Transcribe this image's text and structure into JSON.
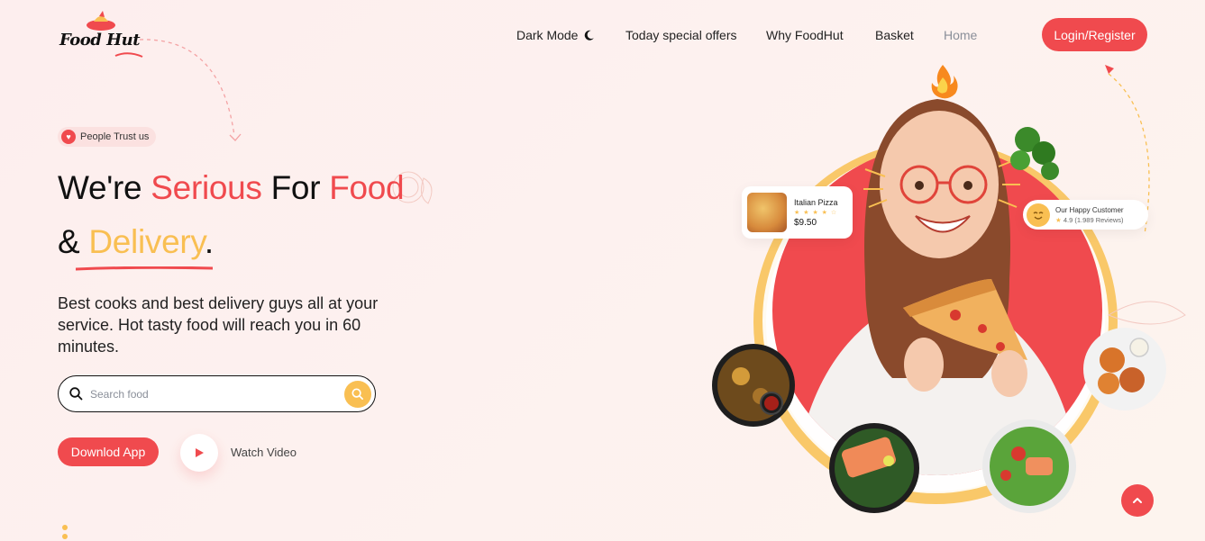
{
  "nav": {
    "logo_text": "Food Hut",
    "items": [
      {
        "label": "Dark Mode",
        "active": false
      },
      {
        "label": "Today special offers",
        "active": false
      },
      {
        "label": "Why FoodHut",
        "active": false
      },
      {
        "label": "Basket",
        "active": false
      },
      {
        "label": "Home",
        "active": true
      }
    ],
    "login_label": "Login/Register"
  },
  "hero": {
    "badge": "People Trust us",
    "headline": {
      "part1": "We're ",
      "part2": "Serious",
      "part3": " For ",
      "part4": "Food",
      "part5": "& ",
      "part6": "Delivery",
      "part7": "."
    },
    "description": "Best cooks and best delivery guys all at your service. Hot tasty food will reach you in 60 minutes.",
    "search": {
      "placeholder": "Search food",
      "value": ""
    },
    "download_label": "Downlod App",
    "watch_label": "Watch Video"
  },
  "cards": {
    "pizza": {
      "title": "Italian Pizza",
      "stars": "★ ★ ★ ★ ☆",
      "price": "$9.50"
    },
    "customer": {
      "title": "Our Happy Customer",
      "rating": "4.9",
      "reviews": "(1.989 Reviews)"
    }
  },
  "colors": {
    "accent_red": "#f04a4e",
    "accent_yellow": "#f9bf52",
    "background": "#fdeeee"
  },
  "icons": [
    "logo-icon",
    "moon-icon",
    "heart-icon",
    "search-icon",
    "play-icon",
    "fire-icon",
    "smile-icon",
    "arrow-up-icon"
  ]
}
